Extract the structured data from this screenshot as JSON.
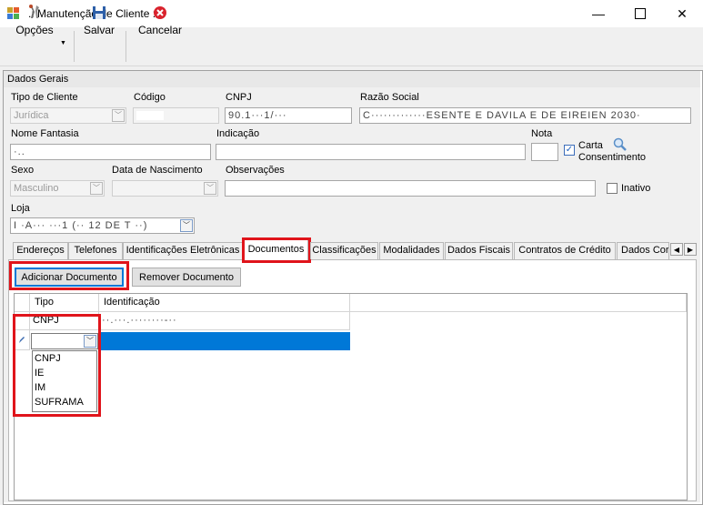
{
  "window": {
    "title": ".: Manutenção de Cliente :."
  },
  "toolbar": {
    "options_label": "Opções",
    "save_label": "Salvar",
    "cancel_label": "Cancelar"
  },
  "group": {
    "title": "Dados Gerais"
  },
  "form": {
    "tipo_cliente_label": "Tipo de Cliente",
    "tipo_cliente_value": "Jurídica",
    "codigo_label": "Código",
    "cnpj_label": "CNPJ",
    "cnpj_value": "90.1···1/···",
    "razao_social_label": "Razão Social",
    "razao_social_value": "C·············ESENTE E DAVILA E DE EIREIEN 2030·",
    "nome_fantasia_label": "Nome Fantasia",
    "nome_fantasia_value": "·..",
    "indicacao_label": "Indicação",
    "nota_label": "Nota",
    "carta_label_1": "Carta",
    "carta_label_2": "Consentimento",
    "sexo_label": "Sexo",
    "sexo_value": "Masculino",
    "nascimento_label": "Data de Nascimento",
    "observacoes_label": "Observações",
    "inativo_label": "Inativo",
    "loja_label": "Loja",
    "loja_value": "I ·A··· ···1 (·· 12 DE T ··)"
  },
  "tabs": [
    "Endereços",
    "Telefones",
    "Identificações Eletrônicas",
    "Documentos",
    "Classificações",
    "Modalidades",
    "Dados Fiscais",
    "Contratos de Crédito",
    "Dados Cor"
  ],
  "documentos": {
    "add_button": "Adicionar Documento",
    "remove_button": "Remover Documento",
    "columns": [
      "Tipo",
      "Identificação"
    ],
    "rows": [
      {
        "tipo": "CNPJ",
        "identificacao": "··.···.········-··"
      }
    ],
    "dropdown_options": [
      "CNPJ",
      "IE",
      "IM",
      "SUFRAMA"
    ]
  },
  "colors": {
    "highlight": "#e0141b",
    "selection": "#0078d7"
  }
}
